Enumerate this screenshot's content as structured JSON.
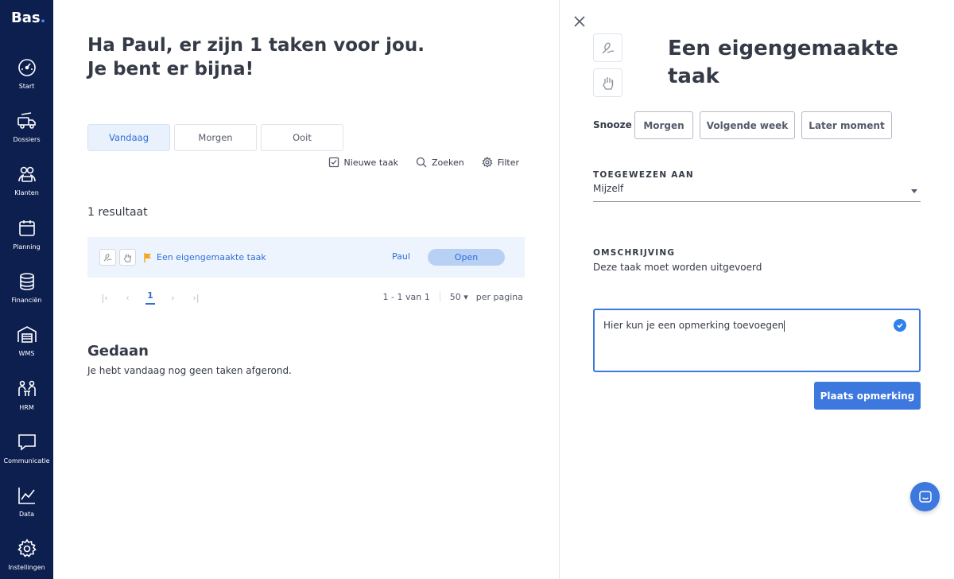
{
  "app": {
    "logo": "Bas",
    "logo_dot": "."
  },
  "sidebar": {
    "items": [
      {
        "label": "Start",
        "icon": "dashboard-gauge-icon"
      },
      {
        "label": "Dossiers",
        "icon": "truck-dossier-icon"
      },
      {
        "label": "Klanten",
        "icon": "customers-icon"
      },
      {
        "label": "Planning",
        "icon": "calendar-icon"
      },
      {
        "label": "Financiën",
        "icon": "coins-stack-icon"
      },
      {
        "label": "WMS",
        "icon": "warehouse-icon"
      },
      {
        "label": "HRM",
        "icon": "people-meeting-icon"
      },
      {
        "label": "Communicatie",
        "icon": "chat-bubble-icon"
      },
      {
        "label": "Data",
        "icon": "line-chart-icon"
      },
      {
        "label": "Instellingen",
        "icon": "gear-icon"
      }
    ]
  },
  "main": {
    "greeting": "Ha Paul, er zijn 1 taken voor jou. Je bent er bijna!",
    "tabs": [
      {
        "label": "Vandaag",
        "active": true
      },
      {
        "label": "Morgen",
        "active": false
      },
      {
        "label": "Ooit",
        "active": false
      }
    ],
    "actions": {
      "new_task": "Nieuwe taak",
      "search": "Zoeken",
      "filter": "Filter"
    },
    "result_count": "1 resultaat",
    "tasks": [
      {
        "title": "Een eigengemaakte taak",
        "owner": "Paul",
        "status": "Open",
        "flag_color": "#f5a623"
      }
    ],
    "pager": {
      "current_page": "1",
      "range": "1 - 1 van 1",
      "per_page_value": "50",
      "per_page_label": "per pagina"
    },
    "done": {
      "title": "Gedaan",
      "text": "Je hebt vandaag nog geen taken afgerond."
    }
  },
  "panel": {
    "title": "Een eigengemaakte taak",
    "snooze": {
      "label": "Snooze",
      "options": [
        "Morgen",
        "Volgende week",
        "Later moment"
      ]
    },
    "assigned": {
      "label": "TOEGEWEZEN AAN",
      "value": "Mijzelf"
    },
    "description": {
      "label": "OMSCHRIJVING",
      "text": "Deze taak moet worden uitgevoerd"
    },
    "comment": {
      "value": "Hier kun je een opmerking toevoegen"
    },
    "submit_label": "Plaats opmerking"
  },
  "colors": {
    "sidebar_bg": "#0d1f4f",
    "accent": "#3c78de",
    "flag": "#f5a623"
  }
}
